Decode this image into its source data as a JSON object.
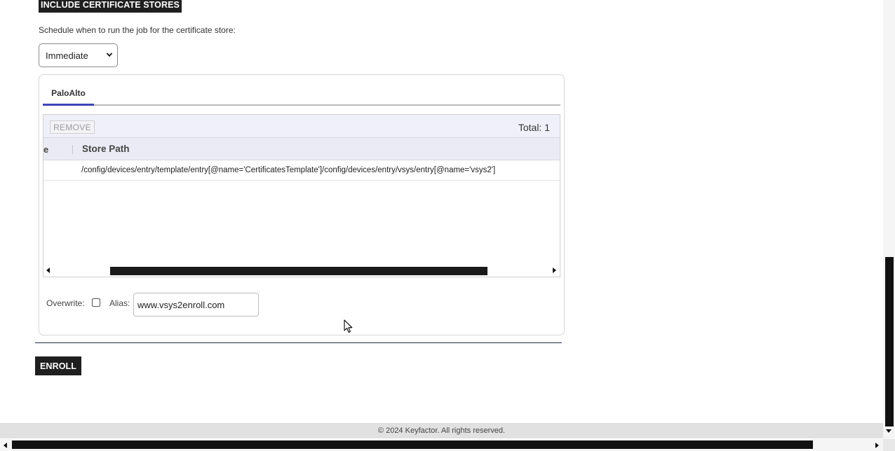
{
  "certificate_stores": {
    "include_button_label": "INCLUDE CERTIFICATE STORES",
    "schedule_label": "Schedule when to run the job for the certificate store:",
    "schedule_select": {
      "selected": "Immediate"
    }
  },
  "store_panel": {
    "tabs": [
      {
        "label": "PaloAlto",
        "active": true
      }
    ],
    "grid": {
      "remove_label": "REMOVE",
      "total_label": "Total: 1",
      "columns": {
        "partial_header": "e",
        "store_path_header": "Store Path"
      },
      "rows": [
        {
          "store_path": "/config/devices/entry/template/entry[@name='CertificatesTemplate']/config/devices/entry/vsys/entry[@name='vsys2']"
        }
      ]
    },
    "overwrite_label": "Overwrite:",
    "overwrite_checked": false,
    "alias_label": "Alias:",
    "alias_value": "www.vsys2enroll.com"
  },
  "enroll_button_label": "ENROLL",
  "footer": {
    "copyright": "© 2024 Keyfactor. All rights reserved."
  },
  "colors": {
    "accent_tab": "#3f45b5",
    "dark_button": "#1f1f1f",
    "grid_header_bg": "#ebebf5"
  },
  "icons": {
    "select_chevron": "chevron-down-icon",
    "scroll_left": "triangle-left-icon",
    "scroll_right": "triangle-right-icon",
    "cursor": "mouse-pointer-icon"
  }
}
